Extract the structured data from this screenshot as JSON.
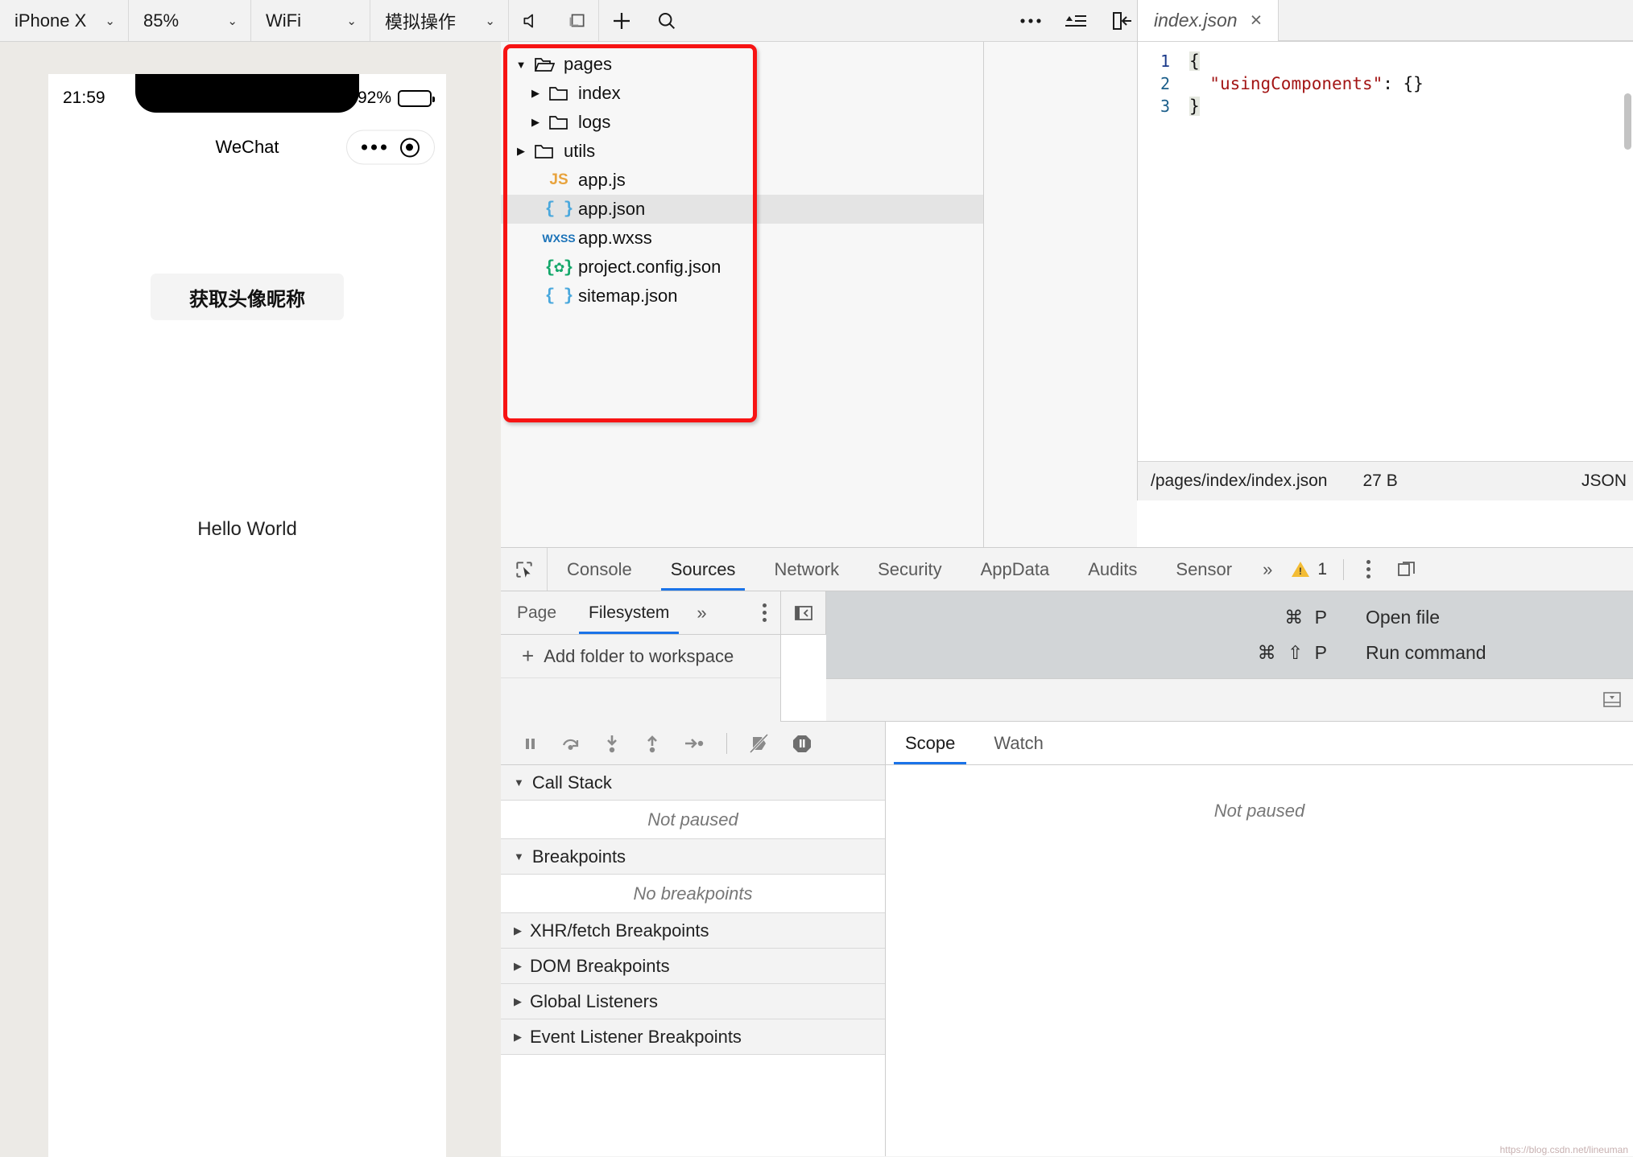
{
  "toolbar": {
    "device": "iPhone X",
    "zoom": "85%",
    "network": "WiFi",
    "simulate": "模拟操作",
    "chevron": "⌄",
    "icons": {
      "mute": "mute-icon",
      "window": "window-icon",
      "add": "+",
      "search": "search-icon",
      "more": "•••",
      "clear": "clear-icon",
      "dock": "dock-left-icon"
    }
  },
  "simulator": {
    "time": "21:59",
    "battery": "92%",
    "nav_title": "WeChat",
    "button_label": "获取头像昵称",
    "body_text": "Hello World"
  },
  "filetree": {
    "rows": [
      {
        "arrow": "▼",
        "icon": "folder-open-icon",
        "label": "pages",
        "indent": 0,
        "selected": false
      },
      {
        "arrow": "▶",
        "icon": "folder-icon",
        "label": "index",
        "indent": 1,
        "selected": false
      },
      {
        "arrow": "▶",
        "icon": "folder-icon",
        "label": "logs",
        "indent": 1,
        "selected": false
      },
      {
        "arrow": "▶",
        "icon": "folder-icon",
        "label": "utils",
        "indent": 0,
        "selected": false
      },
      {
        "arrow": "",
        "icon": "js-file-icon",
        "label": "app.js",
        "indent": 1,
        "selected": false
      },
      {
        "arrow": "",
        "icon": "json-file-icon",
        "label": "app.json",
        "indent": 1,
        "selected": true
      },
      {
        "arrow": "",
        "icon": "wxss-file-icon",
        "label": "app.wxss",
        "indent": 1,
        "selected": false
      },
      {
        "arrow": "",
        "icon": "config-file-icon",
        "label": "project.config.json",
        "indent": 1,
        "selected": false
      },
      {
        "arrow": "",
        "icon": "json-file-icon",
        "label": "sitemap.json",
        "indent": 1,
        "selected": false
      }
    ],
    "icon_glyphs": {
      "js": "JS",
      "json": "{ }",
      "wxss": "WXSS",
      "config": "{✿}"
    },
    "highlight_color": "#f71414"
  },
  "editor": {
    "tab_title": "index.json",
    "close_glyph": "×",
    "lines": [
      {
        "num": "1",
        "text": "{"
      },
      {
        "num": "2",
        "text": "    \"usingComponents\": {}"
      },
      {
        "num": "3",
        "text": "}"
      }
    ],
    "code_line2_prefix": "  ",
    "code_line2_key": "\"usingComponents\"",
    "code_line2_rest": ": {}",
    "status": {
      "path": "/pages/index/index.json",
      "size": "27 B",
      "language": "JSON"
    }
  },
  "devtools": {
    "tabs": [
      {
        "label": "Console",
        "active": false
      },
      {
        "label": "Sources",
        "active": true
      },
      {
        "label": "Network",
        "active": false
      },
      {
        "label": "Security",
        "active": false
      },
      {
        "label": "AppData",
        "active": false
      },
      {
        "label": "Audits",
        "active": false
      },
      {
        "label": "Sensor",
        "active": false
      }
    ],
    "overflow": "»",
    "warning_count": "1",
    "sub_tabs": [
      {
        "label": "Page",
        "active": false
      },
      {
        "label": "Filesystem",
        "active": true
      }
    ],
    "sub_overflow": "»",
    "add_folder": "Add folder to workspace",
    "add_folder_plus": "+",
    "shortcuts": [
      {
        "keys": "⌘ P",
        "label": "Open file"
      },
      {
        "keys": "⌘ ⇧ P",
        "label": "Run command"
      }
    ],
    "scope_tabs": [
      {
        "label": "Scope",
        "active": true
      },
      {
        "label": "Watch",
        "active": false
      }
    ],
    "accordion": [
      {
        "title": "Call Stack",
        "tri": "▼",
        "body": "Not paused",
        "has_body": true
      },
      {
        "title": "Breakpoints",
        "tri": "▼",
        "body": "No breakpoints",
        "has_body": true
      },
      {
        "title": "XHR/fetch Breakpoints",
        "tri": "▶",
        "body": "",
        "has_body": false
      },
      {
        "title": "DOM Breakpoints",
        "tri": "▶",
        "body": "",
        "has_body": false
      },
      {
        "title": "Global Listeners",
        "tri": "▶",
        "body": "",
        "has_body": false
      },
      {
        "title": "Event Listener Breakpoints",
        "tri": "▶",
        "body": "",
        "has_body": false
      }
    ],
    "scope_empty": "Not paused",
    "debug_icons": [
      "pause-icon",
      "step-over-icon",
      "step-into-icon",
      "step-out-icon",
      "step-icon",
      "deactivate-breakpoints-icon",
      "pause-on-exceptions-icon"
    ]
  },
  "watermark": "https://blog.csdn.net/lineuman"
}
